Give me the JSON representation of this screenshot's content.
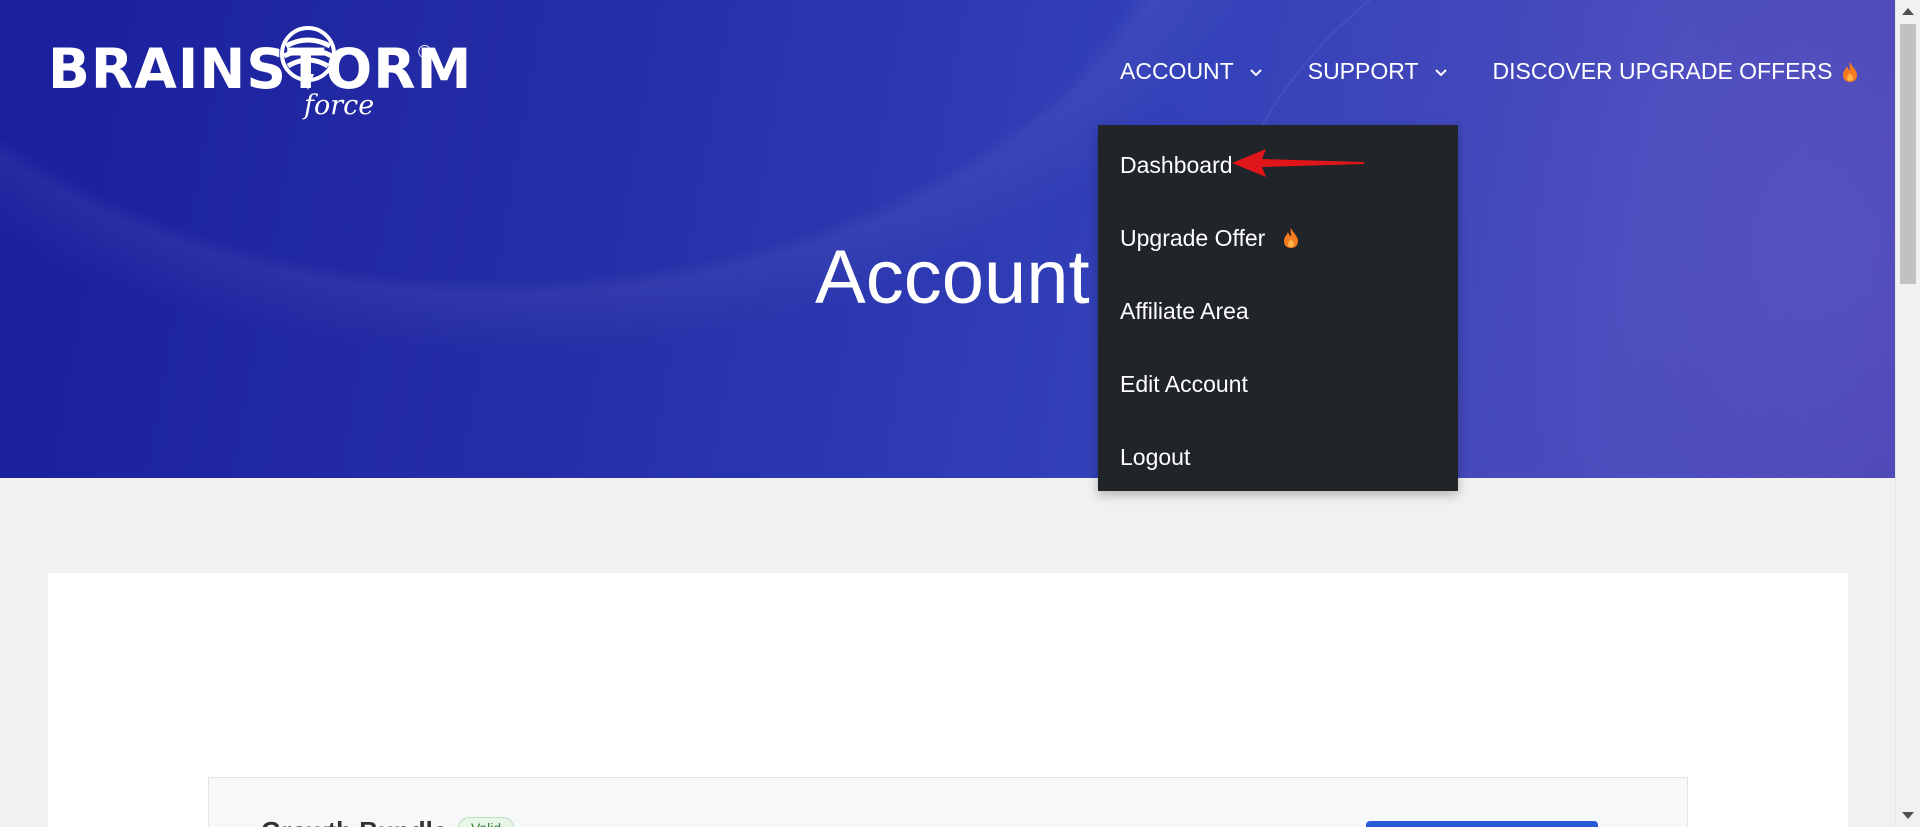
{
  "brand": {
    "logo_text": "BRAINSTORM",
    "logo_sub": "force",
    "registered": "®"
  },
  "nav": {
    "account": "ACCOUNT",
    "support": "SUPPORT",
    "discover": "DISCOVER UPGRADE OFFERS"
  },
  "page": {
    "title": "Account"
  },
  "dropdown": {
    "items": [
      {
        "label": "Dashboard"
      },
      {
        "label": "Upgrade Offer"
      },
      {
        "label": "Affiliate Area"
      },
      {
        "label": "Edit Account"
      },
      {
        "label": "Logout"
      }
    ]
  },
  "content": {
    "product_name": "Growth Bundle",
    "status_badge": "Valid"
  },
  "colors": {
    "hero": "#2730a8",
    "dropdown_bg": "#212428",
    "flame": "#f47b20",
    "annotation_arrow": "#e0161a",
    "primary_button": "#2a5bd7"
  }
}
